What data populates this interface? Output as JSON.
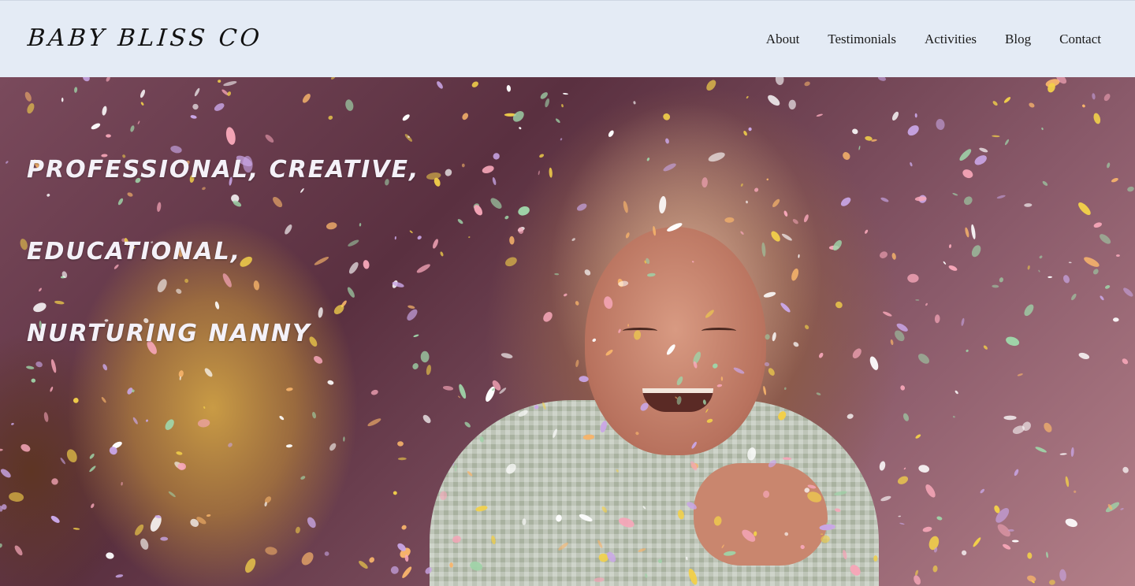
{
  "header": {
    "logo": "BABY BLISS CO",
    "nav": [
      "About",
      "Testimonials",
      "Activities",
      "Blog",
      "Contact"
    ]
  },
  "hero": {
    "headline_line1": "Professional, creative, educational,",
    "headline_line2": "nurturing nanny"
  },
  "colors": {
    "header_bg": "#e4ebf5",
    "headline_text": "#f4f1f8",
    "confetti": [
      "#f2d04a",
      "#f6a6b8",
      "#c9a6e6",
      "#9fd3a8",
      "#ffffff",
      "#f7b46b"
    ]
  }
}
